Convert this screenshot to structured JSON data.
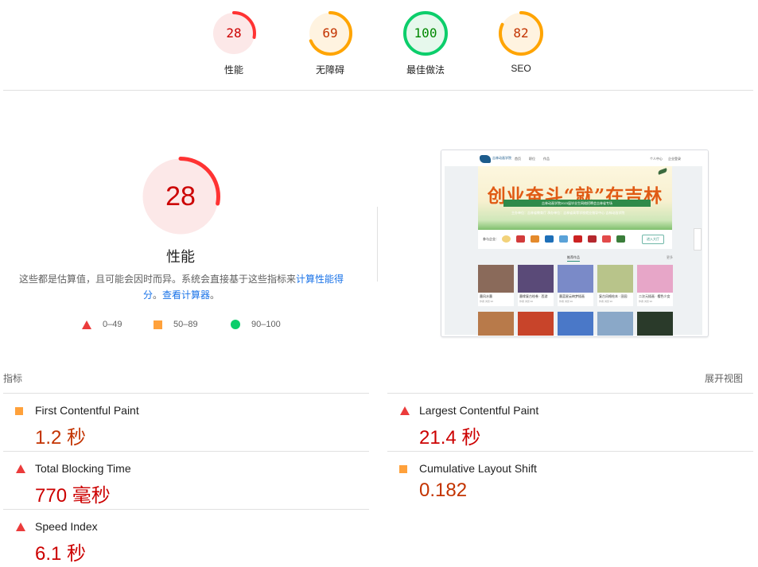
{
  "categories": [
    {
      "label": "性能",
      "score": "28",
      "rating": "fail",
      "fraction": 0.28
    },
    {
      "label": "无障碍",
      "score": "69",
      "rating": "average",
      "fraction": 0.69
    },
    {
      "label": "最佳做法",
      "score": "100",
      "rating": "pass",
      "fraction": 1.0
    },
    {
      "label": "SEO",
      "score": "82",
      "rating": "average",
      "fraction": 0.82
    }
  ],
  "performance": {
    "score": "28",
    "fraction": 0.28,
    "title": "性能",
    "description_prefix": "这些都是估算值，且可能会因时而异。系统会直接基于这些指标来",
    "calc_link": "计算性能得分",
    "description_mid": "。",
    "calculator_link": "查看计算器",
    "description_suffix": "。"
  },
  "legend": [
    {
      "shape": "triangle",
      "range": "0–49",
      "color": "#eb3b3b"
    },
    {
      "shape": "square",
      "range": "50–89",
      "color": "#ffa13b"
    },
    {
      "shape": "circle",
      "range": "90–100",
      "color": "#0cce6b"
    }
  ],
  "screenshot": {
    "brand": "吉林动画学院",
    "nav": [
      "首页",
      "职位",
      "作品"
    ],
    "nav_right": [
      "个人中心",
      "企业登录"
    ],
    "banner_title": "创业奋斗“就”在吉林",
    "banner_strip": "吉林动画学院2023届毕业生网络招聘会吉林省专场",
    "banner_sub": "主办单位：吉林省教育厅  承办单位：吉林省高等学校就业指导中心  吉林动画学院",
    "partners_label": "参与企业：",
    "enter_button": "进入大厅",
    "section_title": "推荐作品",
    "section_more": "更多",
    "cards": [
      {
        "title": "墨风水墨",
        "meta": "作者  浏览 96",
        "color": "#8a6a5a"
      },
      {
        "title": "墨缘复古绘卷 · 西游",
        "meta": "作者  浏览 96",
        "color": "#5a4a78"
      },
      {
        "title": "墨蓝星云绮梦插画",
        "meta": "作者  浏览 96",
        "color": "#7a8ac8"
      },
      {
        "title": "复古风格绘本 · 田园",
        "meta": "作者  浏览 96",
        "color": "#b8c48a"
      },
      {
        "title": "二次元插画 · 樱色少女",
        "meta": "作者  浏览 96",
        "color": "#e7a6c8"
      }
    ],
    "row2_colors": [
      "#b87a4a",
      "#c8442a",
      "#4a78c8",
      "#8aa8c8",
      "#2a3a2a"
    ]
  },
  "metrics_header": {
    "title": "指标",
    "expand": "展开视图"
  },
  "metrics": [
    {
      "name": "First Contentful Paint",
      "value": "1.2 秒",
      "rating": "average"
    },
    {
      "name": "Largest Contentful Paint",
      "value": "21.4 秒",
      "rating": "fail"
    },
    {
      "name": "Total Blocking Time",
      "value": "770 毫秒",
      "rating": "fail"
    },
    {
      "name": "Cumulative Layout Shift",
      "value": "0.182",
      "rating": "average"
    },
    {
      "name": "Speed Index",
      "value": "6.1 秒",
      "rating": "fail"
    }
  ],
  "colors": {
    "fail": "#ff3333",
    "fail_bg": "#fce8e8",
    "fail_text": "#cc0000",
    "average": "#ffa400",
    "average_bg": "#fff3e0",
    "average_text": "#c33300",
    "pass": "#0cce6b",
    "pass_bg": "#e6f8ec",
    "pass_text": "#008800"
  }
}
